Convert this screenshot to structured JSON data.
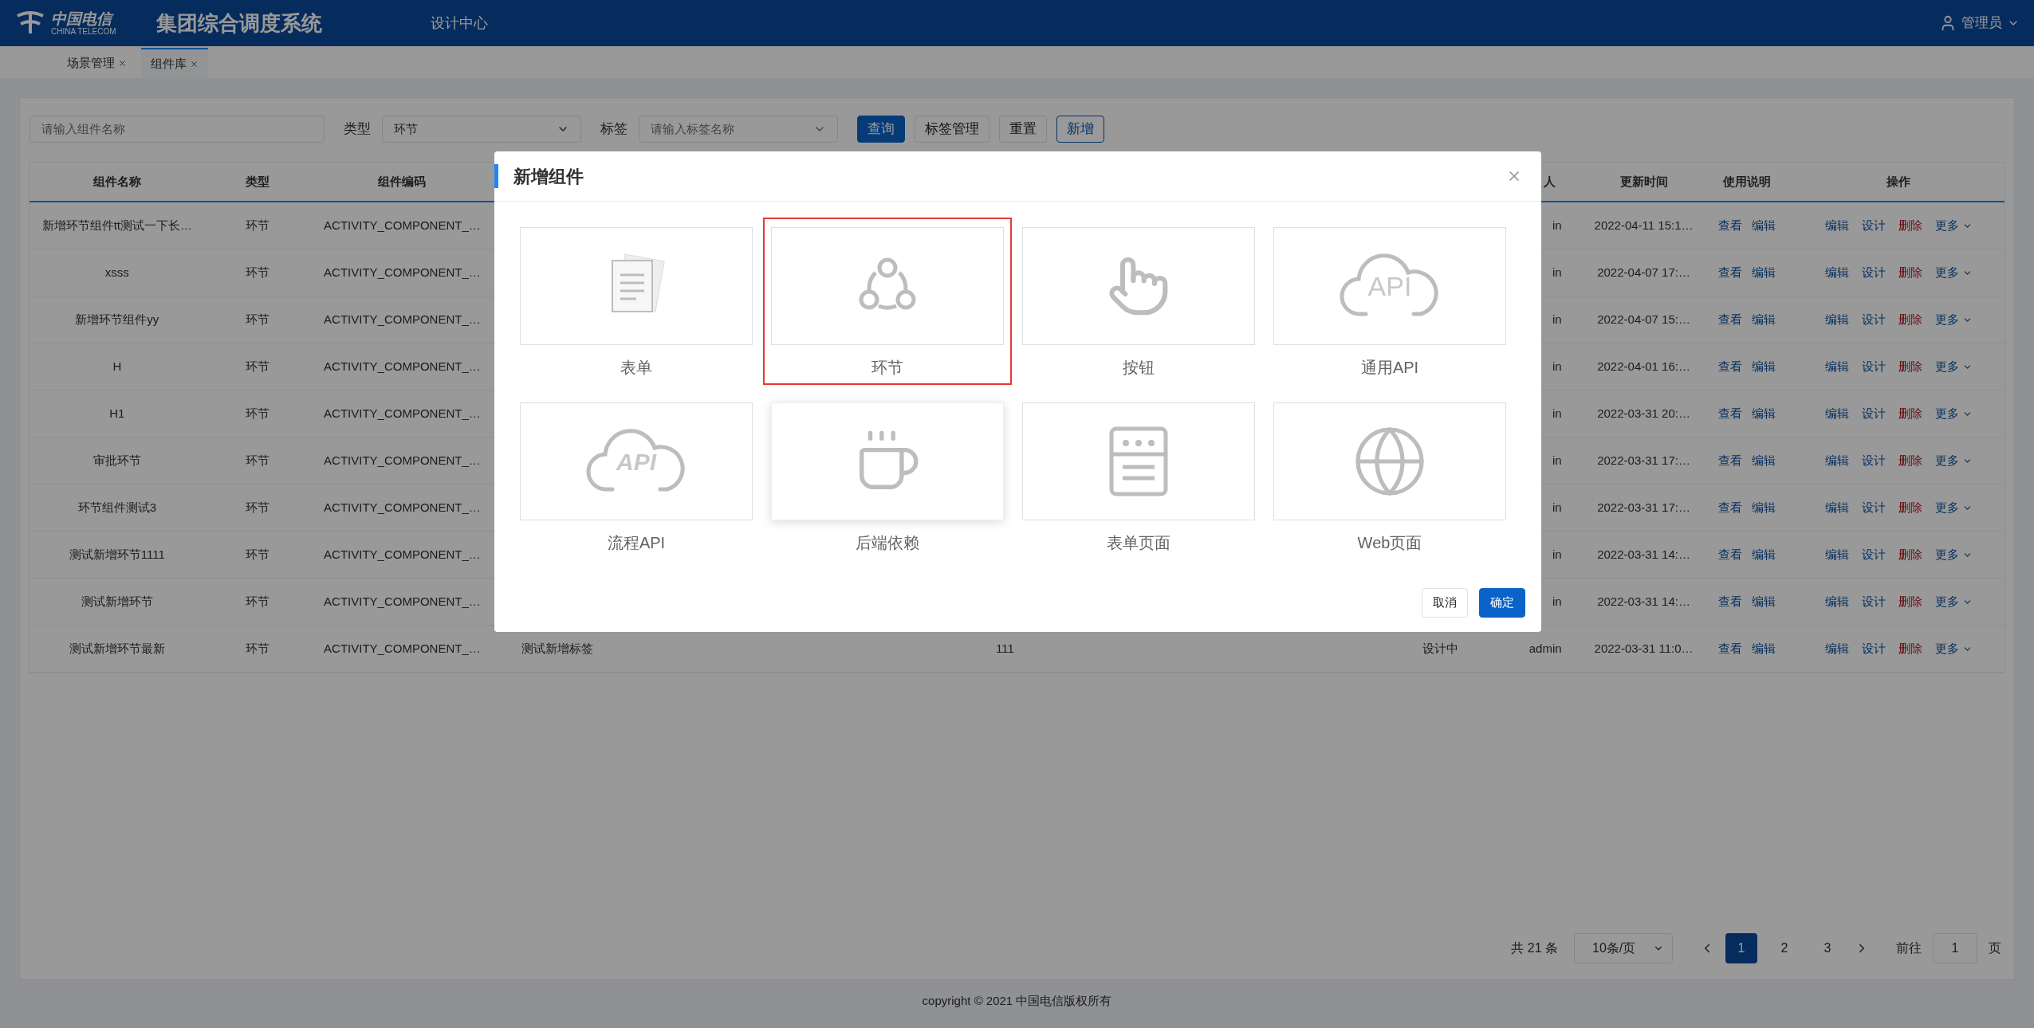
{
  "header": {
    "logo_cn": "中国电信",
    "logo_en": "CHINA TELECOM",
    "title": "集团综合调度系统",
    "nav": "设计中心",
    "user": "管理员"
  },
  "tabs": [
    {
      "label": "场景管理",
      "selected": false
    },
    {
      "label": "组件库",
      "selected": true
    }
  ],
  "filters": {
    "name_placeholder": "请输入组件名称",
    "type_label": "类型",
    "type_value": "环节",
    "tag_label": "标签",
    "tag_placeholder": "请输入标签名称",
    "buttons": [
      {
        "label": "查询",
        "kind": "primary"
      },
      {
        "label": "标签管理",
        "kind": "default"
      },
      {
        "label": "重置",
        "kind": "default"
      },
      {
        "label": "新增",
        "kind": "outline"
      }
    ]
  },
  "table": {
    "columns": {
      "name": "组件名称",
      "type": "类型",
      "code": "组件编码",
      "creator": "人",
      "updated": "更新时间",
      "help": "使用说明",
      "actions": "操作"
    },
    "rows": [
      {
        "name": "新增环节组件tt测试一下长…",
        "type": "环节",
        "code": "ACTIVITY_COMPONENT_…",
        "creator": "in",
        "updated": "2022-04-11 15:1…",
        "help": [
          "查看",
          "编辑"
        ],
        "actions": [
          {
            "label": "编辑",
            "kind": "link"
          },
          {
            "label": "设计",
            "kind": "link"
          },
          {
            "label": "删除",
            "kind": "danger"
          },
          {
            "label": "更多",
            "kind": "dropdown"
          }
        ]
      },
      {
        "name": "xsss",
        "type": "环节",
        "code": "ACTIVITY_COMPONENT_…",
        "creator": "in",
        "updated": "2022-04-07 17:…",
        "help": [
          "查看",
          "编辑"
        ],
        "actions": [
          {
            "label": "编辑",
            "kind": "link"
          },
          {
            "label": "设计",
            "kind": "link"
          },
          {
            "label": "删除",
            "kind": "danger"
          },
          {
            "label": "更多",
            "kind": "dropdown"
          }
        ]
      },
      {
        "name": "新增环节组件yy",
        "type": "环节",
        "code": "ACTIVITY_COMPONENT_…",
        "creator": "in",
        "updated": "2022-04-07 15:…",
        "help": [
          "查看",
          "编辑"
        ],
        "actions": [
          {
            "label": "编辑",
            "kind": "link"
          },
          {
            "label": "设计",
            "kind": "link"
          },
          {
            "label": "删除",
            "kind": "danger"
          },
          {
            "label": "更多",
            "kind": "dropdown"
          }
        ]
      },
      {
        "name": "H",
        "type": "环节",
        "code": "ACTIVITY_COMPONENT_…",
        "creator": "in",
        "updated": "2022-04-01 16:…",
        "help": [
          "查看",
          "编辑"
        ],
        "actions": [
          {
            "label": "编辑",
            "kind": "link"
          },
          {
            "label": "设计",
            "kind": "link"
          },
          {
            "label": "删除",
            "kind": "danger"
          },
          {
            "label": "更多",
            "kind": "dropdown"
          }
        ]
      },
      {
        "name": "H1",
        "type": "环节",
        "code": "ACTIVITY_COMPONENT_…",
        "creator": "in",
        "updated": "2022-03-31 20:…",
        "help": [
          "查看",
          "编辑"
        ],
        "actions": [
          {
            "label": "编辑",
            "kind": "link"
          },
          {
            "label": "设计",
            "kind": "link"
          },
          {
            "label": "删除",
            "kind": "danger"
          },
          {
            "label": "更多",
            "kind": "dropdown"
          }
        ]
      },
      {
        "name": "审批环节",
        "type": "环节",
        "code": "ACTIVITY_COMPONENT_…",
        "creator": "in",
        "updated": "2022-03-31 17:…",
        "help": [
          "查看",
          "编辑"
        ],
        "actions": [
          {
            "label": "编辑",
            "kind": "link"
          },
          {
            "label": "设计",
            "kind": "link"
          },
          {
            "label": "删除",
            "kind": "danger"
          },
          {
            "label": "更多",
            "kind": "dropdown"
          }
        ]
      },
      {
        "name": "环节组件测试3",
        "type": "环节",
        "code": "ACTIVITY_COMPONENT_…",
        "creator": "in",
        "updated": "2022-03-31 17:…",
        "help": [
          "查看",
          "编辑"
        ],
        "actions": [
          {
            "label": "编辑",
            "kind": "link"
          },
          {
            "label": "设计",
            "kind": "link"
          },
          {
            "label": "删除",
            "kind": "danger"
          },
          {
            "label": "更多",
            "kind": "dropdown"
          }
        ]
      },
      {
        "name": "测试新增环节1111",
        "type": "环节",
        "code": "ACTIVITY_COMPONENT_…",
        "creator": "in",
        "updated": "2022-03-31 14:…",
        "help": [
          "查看",
          "编辑"
        ],
        "actions": [
          {
            "label": "编辑",
            "kind": "link"
          },
          {
            "label": "设计",
            "kind": "link"
          },
          {
            "label": "删除",
            "kind": "danger"
          },
          {
            "label": "更多",
            "kind": "dropdown"
          }
        ]
      },
      {
        "name": "测试新增环节",
        "type": "环节",
        "code": "ACTIVITY_COMPONENT_…",
        "creator": "in",
        "updated": "2022-03-31 14:…",
        "help": [
          "查看",
          "编辑"
        ],
        "actions": [
          {
            "label": "编辑",
            "kind": "link"
          },
          {
            "label": "设计",
            "kind": "link"
          },
          {
            "label": "删除",
            "kind": "danger"
          },
          {
            "label": "更多",
            "kind": "dropdown"
          }
        ]
      },
      {
        "name": "测试新增环节最新",
        "type": "环节",
        "code": "ACTIVITY_COMPONENT_…",
        "tag": "测试新增标签",
        "description": "111",
        "status": "设计中",
        "creator": "admin",
        "updated": "2022-03-31 11:0…",
        "help": [
          "查看",
          "编辑"
        ],
        "actions": [
          {
            "label": "编辑",
            "kind": "link"
          },
          {
            "label": "设计",
            "kind": "link"
          },
          {
            "label": "删除",
            "kind": "danger"
          },
          {
            "label": "更多",
            "kind": "dropdown"
          }
        ]
      }
    ]
  },
  "pagination": {
    "total": "共 21 条",
    "page_size": "10条/页",
    "pages": [
      {
        "label": "1",
        "selected": true
      },
      {
        "label": "2",
        "selected": false
      },
      {
        "label": "3",
        "selected": false
      }
    ],
    "goto_label": "前往",
    "goto_value": "1",
    "goto_suffix": "页"
  },
  "footer": "copyright © 2021 中国电信版权所有",
  "dialog": {
    "title": "新增组件",
    "items": [
      {
        "label": "表单",
        "kind": "form",
        "selected": false,
        "hovered": false
      },
      {
        "label": "环节",
        "kind": "cycle",
        "selected": true,
        "hovered": false
      },
      {
        "label": "按钮",
        "kind": "button",
        "selected": false,
        "hovered": false
      },
      {
        "label": "通用API",
        "kind": "cloud-api",
        "icon_text": "API",
        "selected": false,
        "hovered": false
      },
      {
        "label": "流程API",
        "kind": "flow-api",
        "icon_text": "API",
        "selected": false,
        "hovered": false
      },
      {
        "label": "后端依赖",
        "kind": "java",
        "selected": false,
        "hovered": true
      },
      {
        "label": "表单页面",
        "kind": "page",
        "selected": false,
        "hovered": false
      },
      {
        "label": "Web页面",
        "kind": "web",
        "selected": false,
        "hovered": false
      }
    ],
    "buttons": [
      {
        "label": "取消",
        "kind": "default"
      },
      {
        "label": "确定",
        "kind": "primary"
      }
    ]
  }
}
